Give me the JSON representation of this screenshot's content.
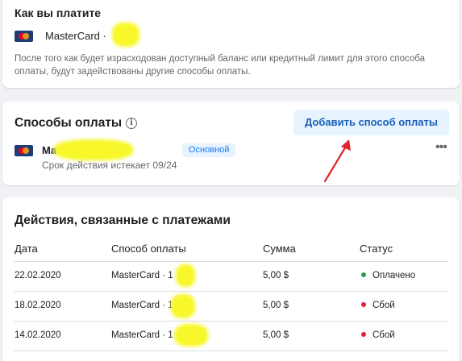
{
  "how_you_pay": {
    "title": "Как вы платите",
    "card_name": "MasterCard · ",
    "note": "После того как будет израсходован доступный баланс или кредитный лимит для этого способа оплаты, будут задействованы другие способы оплаты."
  },
  "payment_methods": {
    "title": "Способы оплаты",
    "info_icon": "i",
    "add_button": "Добавить способ оплаты",
    "card_name": "Ma",
    "badge": "Основной",
    "expiry": "Срок действия истекает 09/24",
    "more": "•••"
  },
  "transactions": {
    "title": "Действия, связанные с платежами",
    "columns": [
      "Дата",
      "Способ оплаты",
      "Сумма",
      "Статус"
    ],
    "rows": [
      {
        "date": "22.02.2020",
        "method": "MasterCard · 1",
        "amount": "5,00 $",
        "status": "Оплачено",
        "status_color": "#2e9e47"
      },
      {
        "date": "18.02.2020",
        "method": "MasterCard · 1",
        "amount": "5,00 $",
        "status": "Сбой",
        "status_color": "#e41e3f"
      },
      {
        "date": "14.02.2020",
        "method": "MasterCard · 1",
        "amount": "5,00 $",
        "status": "Сбой",
        "status_color": "#e41e3f"
      }
    ]
  },
  "colors": {
    "accent": "#1877f2",
    "button_bg": "#e7f3ff",
    "arrow": "#e0242c",
    "redaction": "#f7f72a"
  }
}
